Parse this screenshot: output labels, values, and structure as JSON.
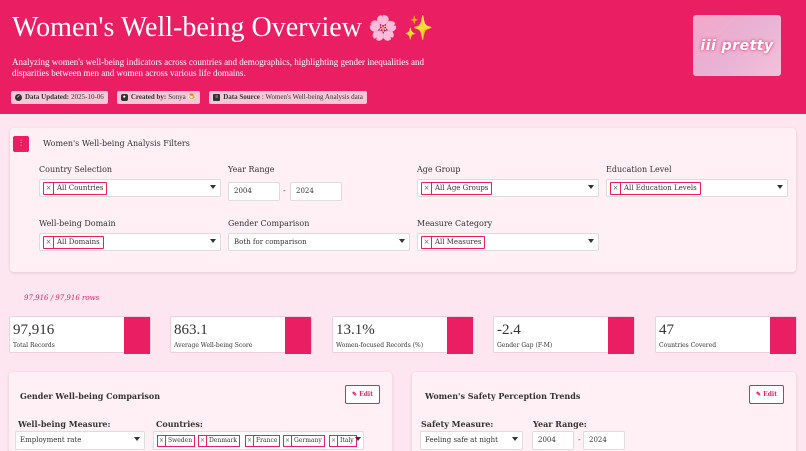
{
  "header": {
    "title": "Women's Well-being Overview",
    "title_emoji": "🌸 ✨",
    "subtitle": "Analyzing women's well-being indicators across countries and demographics, highlighting gender inequalities and disparities between men and women across various life domains.",
    "badges": [
      {
        "icon": "check-circle-icon",
        "label": "Data Updated:",
        "value": "2025-10-06"
      },
      {
        "icon": "user-icon",
        "label": "Created by:",
        "value": "Sonya 🍮"
      },
      {
        "icon": "database-icon",
        "label": "Data Source",
        "value": ": Women's Well-being Analysis data"
      }
    ],
    "logo_text": "iii pretty"
  },
  "filters": {
    "title": "Women's Well-being Analysis Filters",
    "country": {
      "label": "Country Selection",
      "chip": "All Countries"
    },
    "year": {
      "label": "Year Range",
      "from": "2004",
      "separator": "-",
      "to": "2024"
    },
    "age": {
      "label": "Age Group",
      "chip": "All Age Groups"
    },
    "education": {
      "label": "Education Level",
      "chip": "All Education Levels"
    },
    "domain": {
      "label": "Well-being Domain",
      "chip": "All Domains"
    },
    "gender": {
      "label": "Gender Comparison",
      "value": "Both for comparison"
    },
    "measure": {
      "label": "Measure Category",
      "chip": "All Measures"
    }
  },
  "rows_text": "97,916 / 97,916 rows",
  "kpis": [
    {
      "value": "97,916",
      "label": "Total Records"
    },
    {
      "value": "863.1",
      "label": "Average Well-being Score"
    },
    {
      "value": "13.1%",
      "label": "Women-focused Records (%)"
    },
    {
      "value": "-2.4",
      "label": "Gender Gap (F-M)"
    },
    {
      "value": "47",
      "label": "Countries Covered"
    }
  ],
  "panel_left": {
    "title": "Gender Well-being Comparison",
    "edit_label": "✎ Edit",
    "measure_label": "Well-being Measure:",
    "measure_value": "Employment rate",
    "countries_label": "Countries:",
    "countries": [
      "Sweden",
      "Denmark",
      "France",
      "Germany",
      "Italy"
    ]
  },
  "panel_right": {
    "title": "Women's Safety Perception Trends",
    "edit_label": "✎ Edit",
    "measure_label": "Safety Measure:",
    "measure_value": "Feeling safe at night",
    "year_label": "Year Range:",
    "from": "2004",
    "separator": "-",
    "to": "2024"
  },
  "colors": {
    "accent": "#e91e63",
    "background": "#fde6ef",
    "panel": "#fff0f5"
  }
}
